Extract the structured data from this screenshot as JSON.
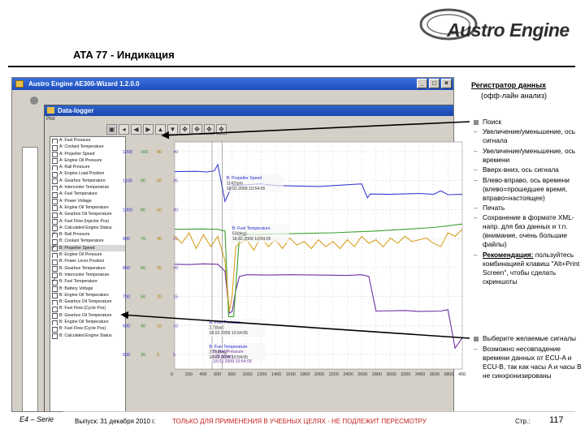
{
  "brand": "Austro Engine",
  "slide_title": "ATA 77 - Индикация",
  "app_window": {
    "title": "Austro Engine AE300-Wizard 1.2.0.0",
    "min_glyph": "_",
    "max_glyph": "□",
    "close_glyph": "×"
  },
  "data_logger": {
    "title": "Data-logger",
    "tab_label": "Plot",
    "toolbar_glyphs": [
      "▣",
      "◂",
      "◀",
      "▶",
      "▲",
      "▼",
      "✥",
      "✥",
      "✥",
      "✥"
    ],
    "parameters": [
      {
        "label": "A: Fuel Pressure",
        "checked": false
      },
      {
        "label": "A: Coolant Temperature",
        "checked": false
      },
      {
        "label": "A: Propeller Speed",
        "checked": false
      },
      {
        "label": "A: Engine Oil Pressure",
        "checked": false
      },
      {
        "label": "A: Rail Pressure",
        "checked": false
      },
      {
        "label": "A: Engine Load Position",
        "checked": false
      },
      {
        "label": "A: Gearbox Temperature",
        "checked": false
      },
      {
        "label": "A: Intercooler Temperature",
        "checked": false
      },
      {
        "label": "A: Fuel Temperature",
        "checked": false
      },
      {
        "label": "A: Power Voltage",
        "checked": false
      },
      {
        "label": "A: Engine Oil Temperature",
        "checked": false
      },
      {
        "label": "A: Gearbox Oil Temperature",
        "checked": false
      },
      {
        "label": "A: Fuel Flow (Injector Pos)",
        "checked": false
      },
      {
        "label": "A: Calculated Engine Status",
        "checked": false
      },
      {
        "label": "B: Rail Pressure",
        "checked": true
      },
      {
        "label": "B: Coolant Temperature",
        "checked": false
      },
      {
        "label": "B: Propeller Speed",
        "checked": true
      },
      {
        "label": "B: Engine Oil Pressure",
        "checked": false
      },
      {
        "label": "B: Power Lever Position",
        "checked": false
      },
      {
        "label": "B: Gearbox Temperature",
        "checked": false
      },
      {
        "label": "B: Intercooler Temperature",
        "checked": false
      },
      {
        "label": "B: Fuel Temperature",
        "checked": true
      },
      {
        "label": "B: Battery Voltage",
        "checked": false
      },
      {
        "label": "B: Engine Oil Temperature",
        "checked": false
      },
      {
        "label": "B: Gearbox Oil Temperature",
        "checked": false
      },
      {
        "label": "B: Fuel Flow (Cycle Pos)",
        "checked": false
      },
      {
        "label": "B: Gearbox Oil Temperature",
        "checked": false
      },
      {
        "label": "B: Engine Oil Temperature",
        "checked": false
      },
      {
        "label": "B: Fuel Flow (Cycle Pos)",
        "checked": false
      },
      {
        "label": "B: Calculated Engine Status",
        "checked": false
      }
    ]
  },
  "chart_data": {
    "type": "line",
    "x_ticks": [
      "0",
      "200",
      "400",
      "600",
      "800",
      "1000",
      "1200",
      "1400",
      "1600",
      "1800",
      "2000",
      "2200",
      "2400",
      "2600",
      "2800",
      "3000",
      "3200",
      "3400",
      "3600",
      "3800",
      "4000"
    ],
    "xlim": [
      0,
      4000
    ],
    "y_ticks": [
      {
        "a": "1200",
        "b": "100",
        "c": "80",
        "d": "40"
      },
      {
        "a": "1100",
        "b": "90",
        "c": "60",
        "d": "35"
      },
      {
        "a": "1000",
        "b": "80",
        "c": "50",
        "d": "30"
      },
      {
        "a": "900",
        "b": "70",
        "c": "40",
        "d": "25"
      },
      {
        "a": "800",
        "b": "60",
        "c": "30",
        "d": "20"
      },
      {
        "a": "700",
        "b": "50",
        "c": "20",
        "d": "15"
      },
      {
        "a": "600",
        "b": "40",
        "c": "10",
        "d": "10"
      },
      {
        "a": "500",
        "b": "30",
        "c": "0",
        "d": "5"
      }
    ],
    "series": [
      {
        "name": "B: Propeller Speed",
        "color": "#3b3bd6",
        "x": [
          0,
          300,
          450,
          550,
          600,
          700,
          800,
          1200,
          1400,
          2000,
          2600,
          2680,
          2720,
          3000,
          3400,
          3600,
          3700,
          3800,
          4000
        ],
        "y": [
          1130,
          1132,
          1128,
          1135,
          1170,
          960,
          1050,
          1060,
          1050,
          1045,
          1060,
          980,
          1002,
          1000,
          1005,
          1000,
          1020,
          998,
          1000
        ]
      },
      {
        "name": "B: Rail Pressure",
        "color": "#7030a0",
        "x": [
          0,
          200,
          400,
          600,
          700,
          760,
          800,
          850,
          900,
          1000,
          1300,
          1600,
          2000,
          2400,
          2600,
          2700,
          2800,
          3200,
          3400,
          3700,
          3800,
          3900,
          4000
        ],
        "y": [
          600,
          598,
          602,
          600,
          560,
          320,
          330,
          450,
          530,
          540,
          538,
          540,
          538,
          536,
          540,
          530,
          332,
          335,
          330,
          332,
          340,
          120,
          180
        ]
      },
      {
        "name": "B: Fuel Temperature",
        "color": "#3aa02e",
        "x": [
          0,
          400,
          600,
          700,
          750,
          820,
          900,
          1000,
          1600,
          2200,
          2800,
          3200,
          3600,
          4000
        ],
        "y": [
          800,
          802,
          800,
          790,
          300,
          300,
          760,
          770,
          775,
          780,
          790,
          800,
          810,
          830
        ]
      },
      {
        "name": "A: Fuel Pressure",
        "color": "#d9a020",
        "x": [
          0,
          100,
          200,
          300,
          400,
          500,
          600,
          700,
          760,
          800,
          850,
          900,
          1000,
          1100,
          1200,
          1300,
          1400,
          1500,
          1600,
          1700,
          1800,
          1900,
          2000,
          2100,
          2200,
          2300,
          2400,
          2500,
          2600,
          2700,
          2800,
          2900,
          3000,
          3100,
          3200,
          3300,
          3400,
          3500,
          3600,
          3700,
          3800,
          3900,
          4000
        ],
        "y": [
          760,
          720,
          780,
          690,
          770,
          700,
          760,
          620,
          330,
          420,
          700,
          720,
          740,
          680,
          760,
          700,
          740,
          690,
          750,
          710,
          730,
          690,
          740,
          700,
          730,
          690,
          740,
          700,
          760,
          720,
          740,
          700,
          750,
          720,
          760,
          730,
          740,
          750,
          720,
          700,
          780,
          760,
          800
        ]
      }
    ],
    "annotations": [
      "B: Propeller Speed",
      "1142rpm",
      "18.02.2009 10:54:05",
      "B: Fuel Temperature",
      "53(deg)",
      "18.02.2009 10:54:05",
      "A: Fuel Pressure",
      "2.7(bar)",
      "18.02.2009 10:54:05",
      "B: Fuel Temperature",
      "27.5(deg)",
      "18.02.2009 10:54:05",
      "B: Rail Pressure",
      "129.6(bar)",
      "18.02.2009 10:54:05"
    ]
  },
  "right_panel": {
    "title": "Регистратор данных",
    "subtitle": "(офф-лайн анализ)",
    "items": [
      "Поиск",
      "Увеличение/уменьшение, ось сигнала",
      "Увеличение/уменьшение, ось времени",
      "Вверх-вниз, ось сигнала",
      "Влево-вправо, ось времени (влево=прошедшее время, вправо=настоящее)",
      "Печать",
      "Сохранение в формате XML-напр. для баз данных и т.п. (внимание, очень большие файлы)"
    ],
    "recommendation_label": "Рекомендация:",
    "recommendation_text": "пользуйтесь комбинацией клавиш \"Alt+Print Screen\", чтобы сделать скриншоты",
    "select_title": "Выберите желаемые сигналы",
    "select_note": "Возможно несовпадение времени данных от ECU-A и ECU-B, так как часы A и часы B не синхронизированы"
  },
  "footer": {
    "edition": "E4 – Serie",
    "release": "Выпуск: 31 декабря 2010 г.",
    "training": "ТОЛЬКО ДЛЯ ПРИМЕНЕНИЯ В УЧЕБНЫХ ЦЕЛЯХ - НЕ ПОДЛЕЖИТ ПЕРЕСМОТРУ",
    "page_label": "Стр.:",
    "page_number": "117"
  }
}
